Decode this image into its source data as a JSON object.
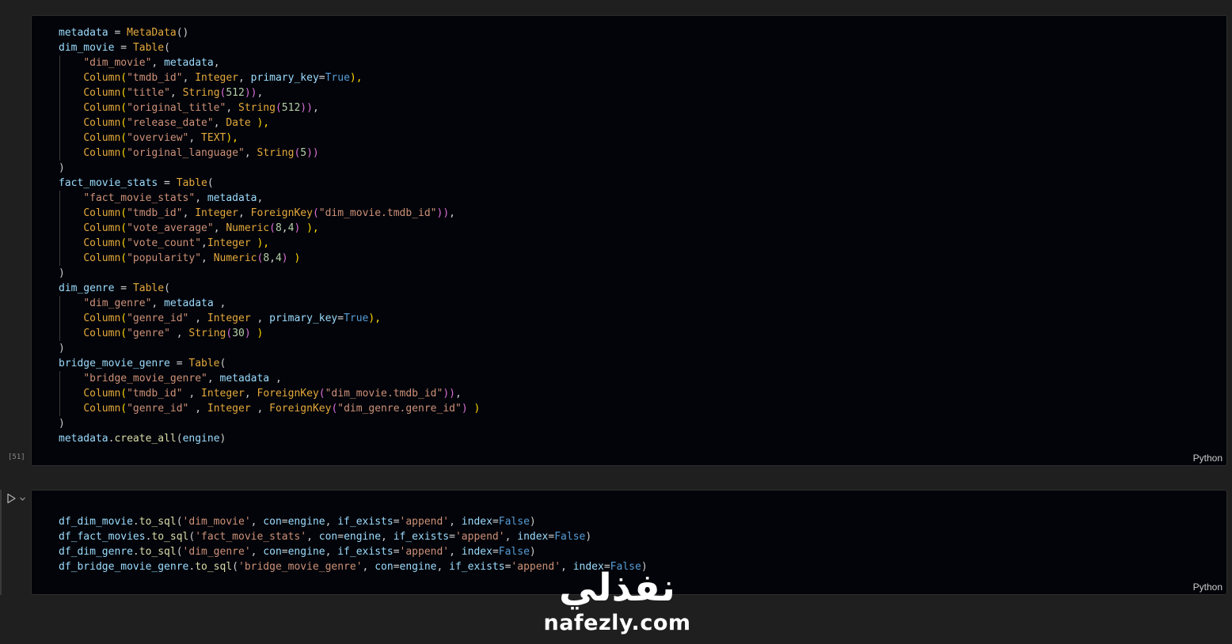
{
  "cell1": {
    "exec_count": "[51]",
    "language": "Python",
    "lines": [
      {
        "t": [
          [
            "metadata",
            "var"
          ],
          [
            " = ",
            "op"
          ],
          [
            "MetaData",
            "cls"
          ],
          [
            "()",
            "p"
          ]
        ]
      },
      {
        "t": [
          [
            "dim_movie",
            "var"
          ],
          [
            " = ",
            "op"
          ],
          [
            "Table",
            "cls"
          ],
          [
            "(",
            "p"
          ]
        ]
      },
      {
        "t": [
          [
            "    ",
            "p"
          ],
          [
            "\"dim_movie\"",
            "str"
          ],
          [
            ", ",
            "p"
          ],
          [
            "metadata",
            "var"
          ],
          [
            ",",
            "p"
          ]
        ]
      },
      {
        "t": [
          [
            "    ",
            "p"
          ],
          [
            "Column",
            "cls"
          ],
          [
            "(",
            "pb"
          ],
          [
            "\"tmdb_id\"",
            "str"
          ],
          [
            ", ",
            "p"
          ],
          [
            "Integer",
            "cls"
          ],
          [
            ", ",
            "p"
          ],
          [
            "primary_key",
            "var"
          ],
          [
            "=",
            "op"
          ],
          [
            "True",
            "kw"
          ],
          [
            "),",
            "pb"
          ]
        ]
      },
      {
        "t": [
          [
            "    ",
            "p"
          ],
          [
            "Column",
            "cls"
          ],
          [
            "(",
            "pb"
          ],
          [
            "\"title\"",
            "str"
          ],
          [
            ", ",
            "p"
          ],
          [
            "String",
            "cls"
          ],
          [
            "(",
            "pp"
          ],
          [
            "512",
            "num"
          ],
          [
            "))",
            "pp"
          ],
          [
            ",",
            "p"
          ]
        ]
      },
      {
        "t": [
          [
            "    ",
            "p"
          ],
          [
            "Column",
            "cls"
          ],
          [
            "(",
            "pb"
          ],
          [
            "\"original_title\"",
            "str"
          ],
          [
            ", ",
            "p"
          ],
          [
            "String",
            "cls"
          ],
          [
            "(",
            "pp"
          ],
          [
            "512",
            "num"
          ],
          [
            "))",
            "pp"
          ],
          [
            ",",
            "p"
          ]
        ]
      },
      {
        "t": [
          [
            "    ",
            "p"
          ],
          [
            "Column",
            "cls"
          ],
          [
            "(",
            "pb"
          ],
          [
            "\"release_date\"",
            "str"
          ],
          [
            ", ",
            "p"
          ],
          [
            "Date",
            "cls"
          ],
          [
            " ),",
            "pb"
          ]
        ]
      },
      {
        "t": [
          [
            "    ",
            "p"
          ],
          [
            "Column",
            "cls"
          ],
          [
            "(",
            "pb"
          ],
          [
            "\"overview\"",
            "str"
          ],
          [
            ", ",
            "p"
          ],
          [
            "TEXT",
            "cls"
          ],
          [
            "),",
            "pb"
          ]
        ]
      },
      {
        "t": [
          [
            "    ",
            "p"
          ],
          [
            "Column",
            "cls"
          ],
          [
            "(",
            "pb"
          ],
          [
            "\"original_language\"",
            "str"
          ],
          [
            ", ",
            "p"
          ],
          [
            "String",
            "cls"
          ],
          [
            "(",
            "pp"
          ],
          [
            "5",
            "num"
          ],
          [
            "))",
            "pp"
          ]
        ]
      },
      {
        "t": [
          [
            ")",
            "p"
          ]
        ]
      },
      {
        "t": [
          [
            "fact_movie_stats",
            "var"
          ],
          [
            " = ",
            "op"
          ],
          [
            "Table",
            "cls"
          ],
          [
            "(",
            "p"
          ]
        ]
      },
      {
        "t": [
          [
            "    ",
            "p"
          ],
          [
            "\"fact_movie_stats\"",
            "str"
          ],
          [
            ", ",
            "p"
          ],
          [
            "metadata",
            "var"
          ],
          [
            ",",
            "p"
          ]
        ]
      },
      {
        "t": [
          [
            "    ",
            "p"
          ],
          [
            "Column",
            "cls"
          ],
          [
            "(",
            "pb"
          ],
          [
            "\"tmdb_id\"",
            "str"
          ],
          [
            ", ",
            "p"
          ],
          [
            "Integer",
            "cls"
          ],
          [
            ", ",
            "p"
          ],
          [
            "ForeignKey",
            "cls"
          ],
          [
            "(",
            "pp"
          ],
          [
            "\"dim_movie.tmdb_id\"",
            "str"
          ],
          [
            "))",
            "pp"
          ],
          [
            ",",
            "p"
          ]
        ]
      },
      {
        "t": [
          [
            "    ",
            "p"
          ],
          [
            "Column",
            "cls"
          ],
          [
            "(",
            "pb"
          ],
          [
            "\"vote_average\"",
            "str"
          ],
          [
            ", ",
            "p"
          ],
          [
            "Numeric",
            "cls"
          ],
          [
            "(",
            "pp"
          ],
          [
            "8",
            "num"
          ],
          [
            ",",
            "p"
          ],
          [
            "4",
            "num"
          ],
          [
            ")",
            "pp"
          ],
          [
            " ),",
            "pb"
          ]
        ]
      },
      {
        "t": [
          [
            "    ",
            "p"
          ],
          [
            "Column",
            "cls"
          ],
          [
            "(",
            "pb"
          ],
          [
            "\"vote_count\"",
            "str"
          ],
          [
            ",",
            "p"
          ],
          [
            "Integer",
            "cls"
          ],
          [
            " ),",
            "pb"
          ]
        ]
      },
      {
        "t": [
          [
            "    ",
            "p"
          ],
          [
            "Column",
            "cls"
          ],
          [
            "(",
            "pb"
          ],
          [
            "\"popularity\"",
            "str"
          ],
          [
            ", ",
            "p"
          ],
          [
            "Numeric",
            "cls"
          ],
          [
            "(",
            "pp"
          ],
          [
            "8",
            "num"
          ],
          [
            ",",
            "p"
          ],
          [
            "4",
            "num"
          ],
          [
            ")",
            "pp"
          ],
          [
            " )",
            "pb"
          ]
        ]
      },
      {
        "t": [
          [
            ")",
            "p"
          ]
        ]
      },
      {
        "t": [
          [
            "dim_genre",
            "var"
          ],
          [
            " = ",
            "op"
          ],
          [
            "Table",
            "cls"
          ],
          [
            "(",
            "p"
          ]
        ]
      },
      {
        "t": [
          [
            "    ",
            "p"
          ],
          [
            "\"dim_genre\"",
            "str"
          ],
          [
            ", ",
            "p"
          ],
          [
            "metadata",
            "var"
          ],
          [
            " ,",
            "p"
          ]
        ]
      },
      {
        "t": [
          [
            "    ",
            "p"
          ],
          [
            "Column",
            "cls"
          ],
          [
            "(",
            "pb"
          ],
          [
            "\"genre_id\"",
            "str"
          ],
          [
            " , ",
            "p"
          ],
          [
            "Integer",
            "cls"
          ],
          [
            " , ",
            "p"
          ],
          [
            "primary_key",
            "var"
          ],
          [
            "=",
            "op"
          ],
          [
            "True",
            "kw"
          ],
          [
            "),",
            "pb"
          ]
        ]
      },
      {
        "t": [
          [
            "    ",
            "p"
          ],
          [
            "Column",
            "cls"
          ],
          [
            "(",
            "pb"
          ],
          [
            "\"genre\"",
            "str"
          ],
          [
            " , ",
            "p"
          ],
          [
            "String",
            "cls"
          ],
          [
            "(",
            "pp"
          ],
          [
            "30",
            "num"
          ],
          [
            ")",
            "pp"
          ],
          [
            " )",
            "pb"
          ]
        ]
      },
      {
        "t": [
          [
            ")",
            "p"
          ]
        ]
      },
      {
        "t": [
          [
            "bridge_movie_genre",
            "var"
          ],
          [
            " = ",
            "op"
          ],
          [
            "Table",
            "cls"
          ],
          [
            "(",
            "p"
          ]
        ]
      },
      {
        "t": [
          [
            "    ",
            "p"
          ],
          [
            "\"bridge_movie_genre\"",
            "str"
          ],
          [
            ", ",
            "p"
          ],
          [
            "metadata",
            "var"
          ],
          [
            " ,",
            "p"
          ]
        ]
      },
      {
        "t": [
          [
            "    ",
            "p"
          ],
          [
            "Column",
            "cls"
          ],
          [
            "(",
            "pb"
          ],
          [
            "\"tmdb_id\"",
            "str"
          ],
          [
            " , ",
            "p"
          ],
          [
            "Integer",
            "cls"
          ],
          [
            ", ",
            "p"
          ],
          [
            "ForeignKey",
            "cls"
          ],
          [
            "(",
            "pp"
          ],
          [
            "\"dim_movie.tmdb_id\"",
            "str"
          ],
          [
            "))",
            "pp"
          ],
          [
            ",",
            "p"
          ]
        ]
      },
      {
        "t": [
          [
            "    ",
            "p"
          ],
          [
            "Column",
            "cls"
          ],
          [
            "(",
            "pb"
          ],
          [
            "\"genre_id\"",
            "str"
          ],
          [
            " , ",
            "p"
          ],
          [
            "Integer",
            "cls"
          ],
          [
            " , ",
            "p"
          ],
          [
            "ForeignKey",
            "cls"
          ],
          [
            "(",
            "pp"
          ],
          [
            "\"dim_genre.genre_id\"",
            "str"
          ],
          [
            ")",
            "pp"
          ],
          [
            " )",
            "pb"
          ]
        ]
      },
      {
        "t": [
          [
            ")",
            "p"
          ]
        ]
      },
      {
        "t": [
          [
            "metadata",
            "var"
          ],
          [
            ".",
            "p"
          ],
          [
            "create_all",
            "fn"
          ],
          [
            "(",
            "p"
          ],
          [
            "engine",
            "var"
          ],
          [
            ")",
            "p"
          ]
        ]
      }
    ]
  },
  "cell2": {
    "language": "Python",
    "lines": [
      {
        "t": [
          [
            "df_dim_movie",
            "var"
          ],
          [
            ".",
            "p"
          ],
          [
            "to_sql",
            "fn"
          ],
          [
            "(",
            "p"
          ],
          [
            "'dim_movie'",
            "str"
          ],
          [
            ", ",
            "p"
          ],
          [
            "con",
            "var"
          ],
          [
            "=",
            "op"
          ],
          [
            "engine",
            "var"
          ],
          [
            ", ",
            "p"
          ],
          [
            "if_exists",
            "var"
          ],
          [
            "=",
            "op"
          ],
          [
            "'append'",
            "str"
          ],
          [
            ", ",
            "p"
          ],
          [
            "index",
            "var"
          ],
          [
            "=",
            "op"
          ],
          [
            "False",
            "kw"
          ],
          [
            ")",
            "p"
          ]
        ]
      },
      {
        "t": [
          [
            "df_fact_movies",
            "var"
          ],
          [
            ".",
            "p"
          ],
          [
            "to_sql",
            "fn"
          ],
          [
            "(",
            "p"
          ],
          [
            "'fact_movie_stats'",
            "str"
          ],
          [
            ", ",
            "p"
          ],
          [
            "con",
            "var"
          ],
          [
            "=",
            "op"
          ],
          [
            "engine",
            "var"
          ],
          [
            ", ",
            "p"
          ],
          [
            "if_exists",
            "var"
          ],
          [
            "=",
            "op"
          ],
          [
            "'append'",
            "str"
          ],
          [
            ", ",
            "p"
          ],
          [
            "index",
            "var"
          ],
          [
            "=",
            "op"
          ],
          [
            "False",
            "kw"
          ],
          [
            ")",
            "p"
          ]
        ]
      },
      {
        "t": [
          [
            "df_dim_genre",
            "var"
          ],
          [
            ".",
            "p"
          ],
          [
            "to_sql",
            "fn"
          ],
          [
            "(",
            "p"
          ],
          [
            "'dim_genre'",
            "str"
          ],
          [
            ", ",
            "p"
          ],
          [
            "con",
            "var"
          ],
          [
            "=",
            "op"
          ],
          [
            "engine",
            "var"
          ],
          [
            ", ",
            "p"
          ],
          [
            "if_exists",
            "var"
          ],
          [
            "=",
            "op"
          ],
          [
            "'append'",
            "str"
          ],
          [
            ", ",
            "p"
          ],
          [
            "index",
            "var"
          ],
          [
            "=",
            "op"
          ],
          [
            "False",
            "kw"
          ],
          [
            ")",
            "p"
          ]
        ]
      },
      {
        "t": [
          [
            "df_bridge_movie_genre",
            "var"
          ],
          [
            ".",
            "p"
          ],
          [
            "to_sql",
            "fn"
          ],
          [
            "(",
            "p"
          ],
          [
            "'bridge_movie_genre'",
            "str"
          ],
          [
            ", ",
            "p"
          ],
          [
            "con",
            "var"
          ],
          [
            "=",
            "op"
          ],
          [
            "engine",
            "var"
          ],
          [
            ", ",
            "p"
          ],
          [
            "if_exists",
            "var"
          ],
          [
            "=",
            "op"
          ],
          [
            "'append'",
            "str"
          ],
          [
            ", ",
            "p"
          ],
          [
            "index",
            "var"
          ],
          [
            "=",
            "op"
          ],
          [
            "False",
            "kw"
          ],
          [
            ")",
            "p"
          ]
        ]
      }
    ]
  },
  "watermark": {
    "arabic": "نفذلي",
    "latin": "nafezly.com"
  },
  "colors": {
    "background": "#1f1f1f",
    "cell_background": "#020409",
    "variable": "#9cdcfe",
    "class": "#e5a93b",
    "string": "#ce9178",
    "number": "#b5cea8",
    "keyword": "#569cd6",
    "function": "#dcdcaa"
  },
  "icons": [
    "run-icon",
    "chevron-down-icon"
  ]
}
